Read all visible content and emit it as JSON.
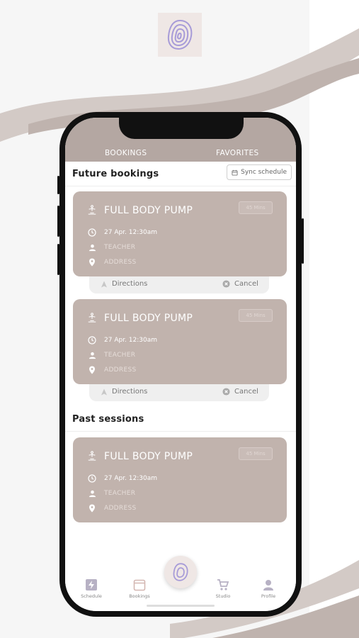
{
  "colors": {
    "accent": "#b4a7a2",
    "card": "#c1b3ad",
    "logo_purple": "#a79bd8",
    "wave": "#c7bcb8"
  },
  "tabs": {
    "bookings": "BOOKINGS",
    "favorites": "FAVORITES"
  },
  "future": {
    "title": "Future bookings",
    "sync_label": "Sync schedule"
  },
  "past": {
    "title": "Past sessions"
  },
  "bookings": [
    {
      "title": "FULL BODY PUMP",
      "badge": "45 Mins",
      "datetime": "27 Apr. 12:30am",
      "teacher": "TEACHER",
      "address": "ADDRESS",
      "directions_label": "Directions",
      "cancel_label": "Cancel"
    },
    {
      "title": "FULL BODY PUMP",
      "badge": "45 Mins",
      "datetime": "27 Apr. 12:30am",
      "teacher": "TEACHER",
      "address": "ADDRESS",
      "directions_label": "Directions",
      "cancel_label": "Cancel"
    }
  ],
  "past_sessions": [
    {
      "title": "FULL BODY PUMP",
      "badge": "45 Mins",
      "datetime": "27 Apr. 12:30am",
      "teacher": "TEACHER",
      "address": "ADDRESS"
    }
  ],
  "nav": {
    "schedule": "Schedule",
    "bookings": "Bookings",
    "studio": "Studio",
    "profile": "Profile"
  },
  "icons": {
    "class": "yoga-class-icon",
    "clock": "clock-icon",
    "teacher": "person-icon",
    "address": "location-pin-icon",
    "directions": "navigation-arrow-icon",
    "cancel": "close-circle-icon",
    "sync": "calendar-icon",
    "logo": "fingerprint-swirl-logo"
  }
}
